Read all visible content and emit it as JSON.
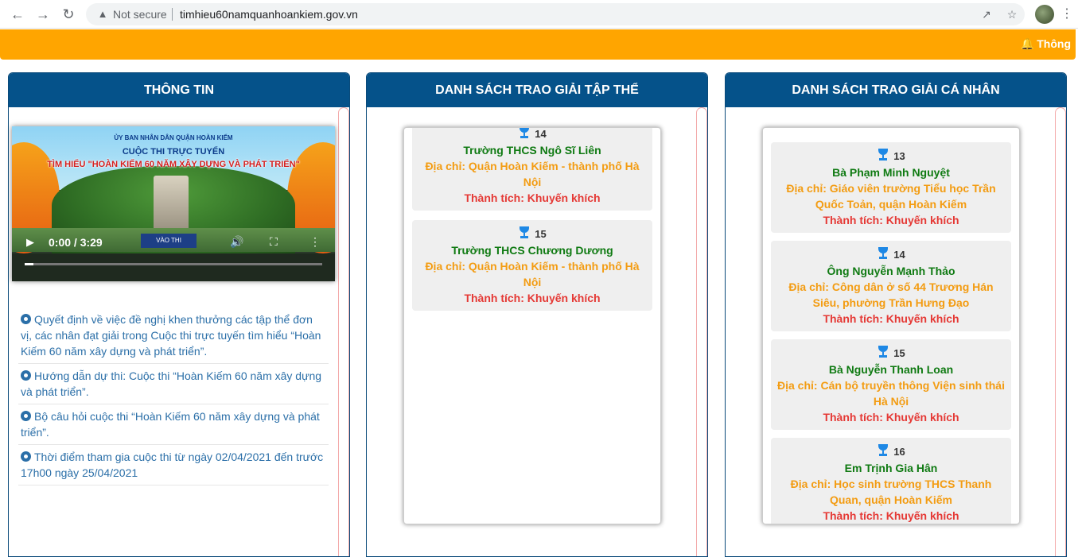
{
  "browser": {
    "security": "Not secure",
    "url": "timhieu60namquanhoankiem.gov.vn"
  },
  "banner": {
    "notification_label": "Thông",
    "color": "#ffa500"
  },
  "panels": {
    "info": {
      "title": "THÔNG TIN",
      "video": {
        "org_line": "ỦY BAN NHÂN DÂN QUẬN HOÀN KIẾM",
        "contest_line": "CUỘC THI TRỰC TUYẾN",
        "title_line": "TÌM HIỂU \"HOÀN KIẾM 60 NĂM XÂY DỰNG VÀ PHÁT TRIỂN\"",
        "button_text": "VÀO THI",
        "time": "0:00 / 3:29",
        "progress": 0.03
      },
      "links": [
        "Quyết định về việc đề nghị khen thưởng các tập thể đơn vị, các nhân đạt giải trong Cuộc thi trực tuyến tìm hiểu “Hoàn Kiếm 60 năm xây dựng và phát triển”.",
        "Hướng dẫn dự thi: Cuộc thi “Hoàn Kiếm 60 năm xây dựng và phát triển”.",
        "Bộ câu hỏi cuộc thi “Hoàn Kiếm 60 năm xây dựng và phát triển”.",
        "Thời điểm tham gia cuộc thi từ ngày 02/04/2021 đến trước 17h00 ngày 25/04/2021"
      ]
    },
    "collective": {
      "title": "DANH SÁCH TRAO GIẢI TẬP THỂ",
      "items": [
        {
          "rank": "14",
          "name": "Trường THCS Ngô Sĩ Liên",
          "address": "Địa chỉ: Quận Hoàn Kiếm - thành phố Hà Nội",
          "achievement": "Thành tích: Khuyến khích"
        },
        {
          "rank": "15",
          "name": "Trường THCS Chương Dương",
          "address": "Địa chỉ: Quận Hoàn Kiếm - thành phố Hà Nội",
          "achievement": "Thành tích: Khuyến khích"
        }
      ]
    },
    "individual": {
      "title": "DANH SÁCH TRAO GIẢI CÁ NHÂN",
      "items": [
        {
          "rank": "13",
          "name": "Bà Phạm Minh Nguyệt",
          "address": "Địa chỉ: Giáo viên trường Tiểu học Trần Quốc Toản, quận Hoàn Kiếm",
          "achievement": "Thành tích: Khuyến khích"
        },
        {
          "rank": "14",
          "name": "Ông Nguyễn Mạnh Thảo",
          "address": "Địa chỉ: Công dân ở số 44 Trương Hán Siêu, phường Trần Hưng Đạo",
          "achievement": "Thành tích: Khuyến khích"
        },
        {
          "rank": "15",
          "name": "Bà Nguyễn Thanh Loan",
          "address": "Địa chỉ: Cán bộ truyền thông Viện sinh thái Hà Nội",
          "achievement": "Thành tích: Khuyến khích"
        },
        {
          "rank": "16",
          "name": "Em Trịnh Gia Hân",
          "address": "Địa chỉ: Học sinh trường THCS Thanh Quan, quận Hoàn Kiếm",
          "achievement": "Thành tích: Khuyến khích"
        }
      ]
    }
  }
}
